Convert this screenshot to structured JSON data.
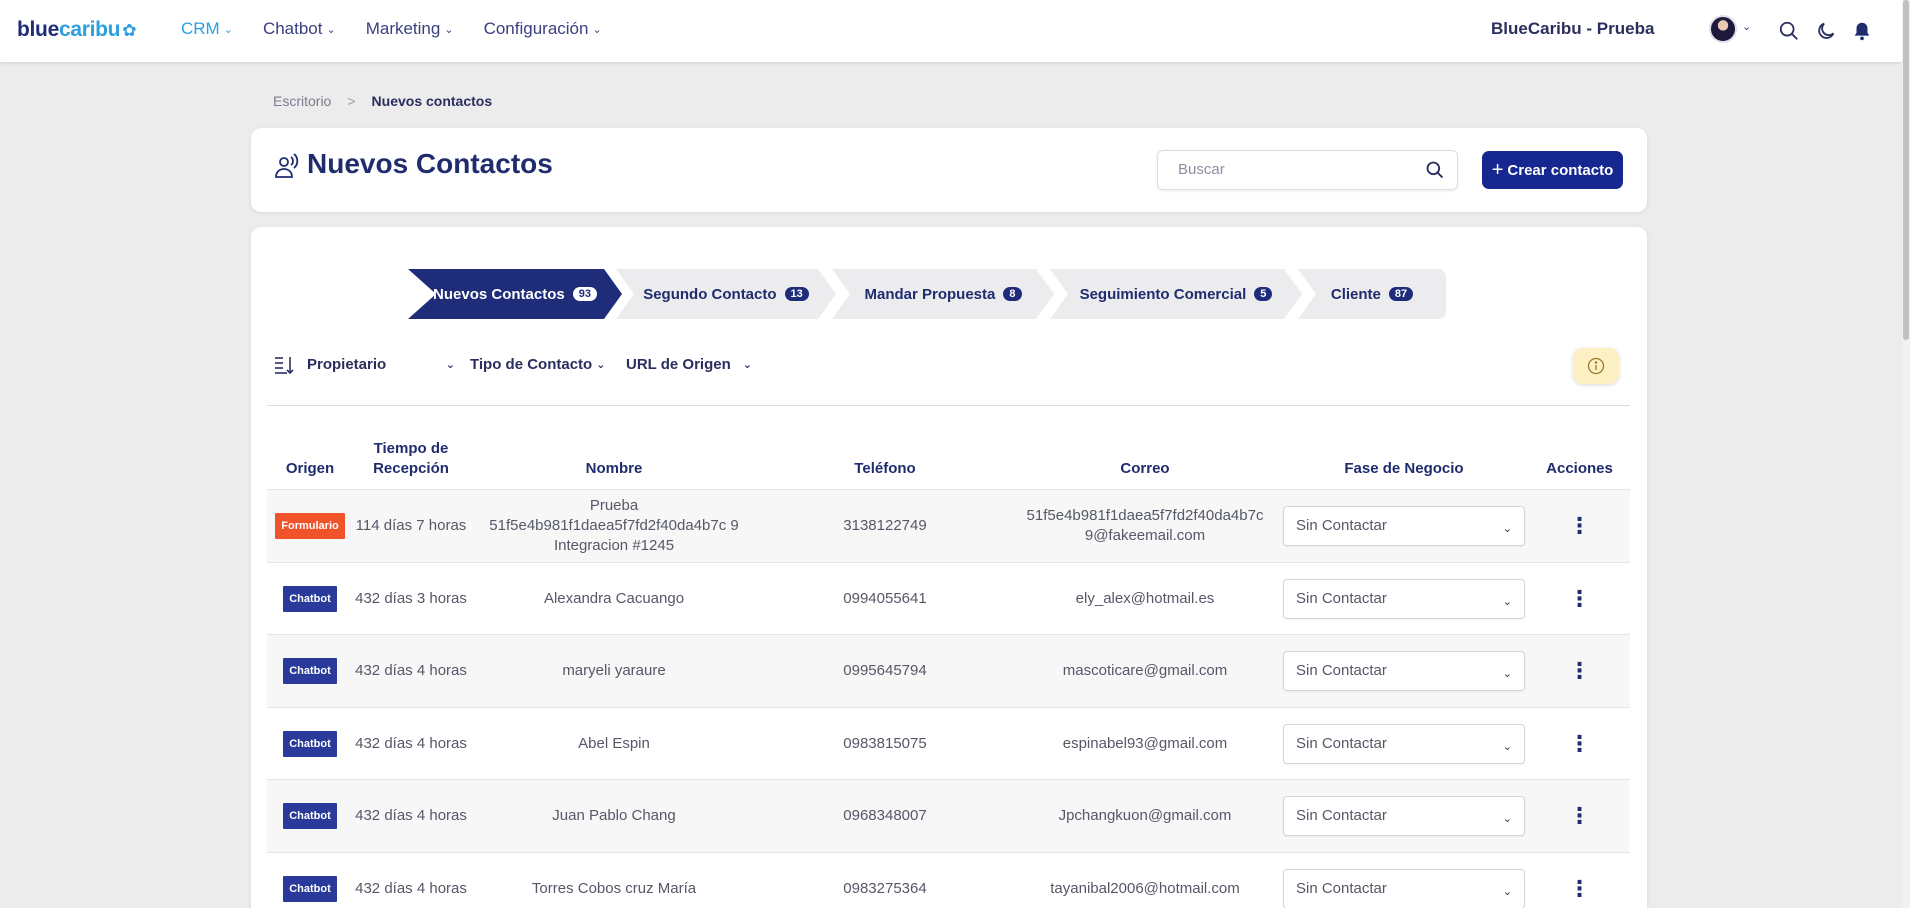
{
  "logo": {
    "part1": "blue",
    "part2": "caribu",
    "mark": "paw-icon"
  },
  "nav": {
    "items": [
      {
        "label": "CRM",
        "active": true
      },
      {
        "label": "Chatbot",
        "active": false
      },
      {
        "label": "Marketing",
        "active": false
      },
      {
        "label": "Configuración",
        "active": false
      }
    ],
    "company": "BlueCaribu - Prueba"
  },
  "breadcrumb": {
    "home": "Escritorio",
    "separator": ">",
    "current": "Nuevos contactos"
  },
  "header": {
    "title": "Nuevos Contactos",
    "search_placeholder": "Buscar",
    "create_label": "Crear contacto"
  },
  "stages": [
    {
      "label": "Nuevos Contactos",
      "count": "93",
      "active": true
    },
    {
      "label": "Segundo Contacto",
      "count": "13",
      "active": false
    },
    {
      "label": "Mandar Propuesta",
      "count": "8",
      "active": false
    },
    {
      "label": "Seguimiento Comercial",
      "count": "5",
      "active": false
    },
    {
      "label": "Cliente",
      "count": "87",
      "active": false
    }
  ],
  "filters": {
    "owner": "Propietario",
    "contact_type": "Tipo de Contacto",
    "origin_url": "URL de Origen"
  },
  "table": {
    "headers": {
      "origin": "Origen",
      "time_line1": "Tiempo de",
      "time_line2": "Recepción",
      "name": "Nombre",
      "phone": "Teléfono",
      "email": "Correo",
      "stage": "Fase de Negocio",
      "actions": "Acciones"
    },
    "rows": [
      {
        "origin": "Formulario",
        "time": "114 días 7 horas",
        "name": "Prueba 51f5e4b981f1daea5f7fd2f40da4b7c 9 Integracion #1245",
        "phone": "3138122749",
        "email": "51f5e4b981f1daea5f7fd2f40da4b7c 9@fakeemail.com",
        "stage": "Sin Contactar"
      },
      {
        "origin": "Chatbot",
        "time": "432 días 3 horas",
        "name": "Alexandra Cacuango",
        "phone": "0994055641",
        "email": "ely_alex@hotmail.es",
        "stage": "Sin Contactar"
      },
      {
        "origin": "Chatbot",
        "time": "432 días 4 horas",
        "name": "maryeli yaraure",
        "phone": "0995645794",
        "email": "mascoticare@gmail.com",
        "stage": "Sin Contactar"
      },
      {
        "origin": "Chatbot",
        "time": "432 días 4 horas",
        "name": "Abel Espin",
        "phone": "0983815075",
        "email": "espinabel93@gmail.com",
        "stage": "Sin Contactar"
      },
      {
        "origin": "Chatbot",
        "time": "432 días 4 horas",
        "name": "Juan Pablo Chang",
        "phone": "0968348007",
        "email": "Jpchangkuon@gmail.com",
        "stage": "Sin Contactar"
      },
      {
        "origin": "Chatbot",
        "time": "432 días 4 horas",
        "name": "Torres Cobos cruz María",
        "phone": "0983275364",
        "email": "tayanibal2006@hotmail.com",
        "stage": "Sin Contactar"
      }
    ]
  },
  "colors": {
    "primary": "#1f2c7a",
    "accent": "#2aa0e0",
    "formulario": "#f0522a",
    "chatbot": "#2a3a9a"
  }
}
